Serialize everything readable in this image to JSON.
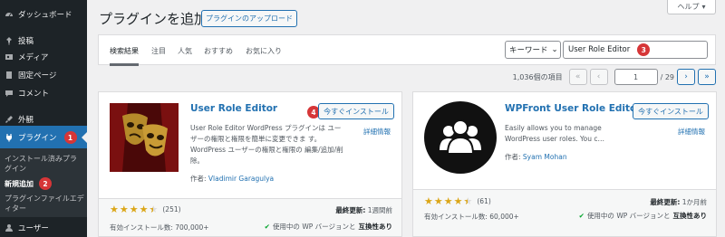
{
  "sidebar": {
    "dashboard": "ダッシュボード",
    "posts": "投稿",
    "media": "メディア",
    "pages": "固定ページ",
    "comments": "コメント",
    "appearance": "外観",
    "plugins": "プラグイン",
    "plugins_badge": "1",
    "sub_installed": "インストール済みプラグイン",
    "sub_add_new": "新規追加",
    "sub_add_new_badge": "2",
    "sub_editor": "プラグインファイルエディター",
    "users": "ユーザー"
  },
  "header": {
    "title": "プラグインを追加",
    "upload_button": "プラグインのアップロード",
    "help": "ヘルプ"
  },
  "filter": {
    "tabs": [
      "検索結果",
      "注目",
      "人気",
      "おすすめ",
      "お気に入り"
    ],
    "select_value": "キーワード",
    "search_value": "User Role Editor",
    "search_badge": "3"
  },
  "pagination": {
    "items_count": "1,036個の項目",
    "first": "«",
    "prev": "‹",
    "current": "1",
    "total": "/ 29",
    "next": "›",
    "last": "»"
  },
  "plugins": [
    {
      "name": "User Role Editor",
      "install_label": "今すぐインストール",
      "install_badge": "4",
      "details": "詳細情報",
      "description": "User Role Editor WordPress プラグインは ユーザーの権限と権限を簡単に変更できま す。WordPress ユーザーの権限と権限の 編集/追加/削除。",
      "author_label": "作者:",
      "author": "Vladimir Garagulya",
      "rating": 4.5,
      "rating_count": "(251)",
      "updated_label": "最終更新:",
      "updated": "1週間前",
      "installs": "有効インストール数: 700,000+",
      "compat_prefix": "使用中の WP バージョンと",
      "compat_strong": "互換性あり"
    },
    {
      "name": "WPFront User Role Editor",
      "install_label": "今すぐインストール",
      "details": "詳細情報",
      "description": "Easily allows you to manage WordPress user roles. You c…",
      "author_label": "作者:",
      "author": "Syam Mohan",
      "rating": 4.5,
      "rating_count": "(61)",
      "updated_label": "最終更新:",
      "updated": "1か月前",
      "installs": "有効インストール数: 60,000+",
      "compat_prefix": "使用中の WP バージョンと",
      "compat_strong": "互換性あり"
    }
  ],
  "colors": {
    "accent": "#2271b1",
    "badge": "#d63638",
    "star": "#dba617"
  }
}
